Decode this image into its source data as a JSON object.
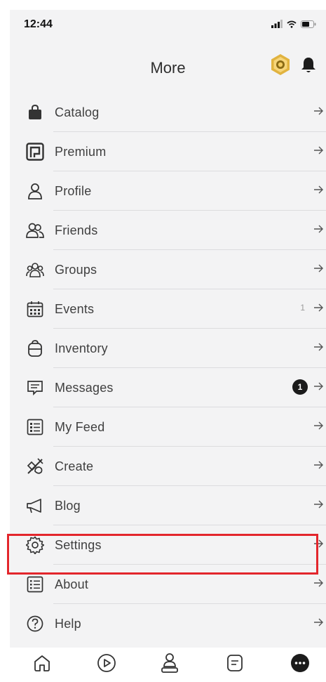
{
  "status_bar": {
    "time": "12:44"
  },
  "header": {
    "title": "More"
  },
  "menu": {
    "items": [
      {
        "label": "Catalog",
        "icon": "shopping-bag-icon"
      },
      {
        "label": "Premium",
        "icon": "premium-icon"
      },
      {
        "label": "Profile",
        "icon": "person-icon"
      },
      {
        "label": "Friends",
        "icon": "friends-icon"
      },
      {
        "label": "Groups",
        "icon": "groups-icon"
      },
      {
        "label": "Events",
        "icon": "calendar-icon",
        "count": "1"
      },
      {
        "label": "Inventory",
        "icon": "backpack-icon"
      },
      {
        "label": "Messages",
        "icon": "message-icon",
        "badge": "1"
      },
      {
        "label": "My Feed",
        "icon": "feed-icon"
      },
      {
        "label": "Create",
        "icon": "create-tools-icon"
      },
      {
        "label": "Blog",
        "icon": "megaphone-icon"
      },
      {
        "label": "Settings",
        "icon": "gear-icon"
      },
      {
        "label": "About",
        "icon": "about-icon"
      },
      {
        "label": "Help",
        "icon": "help-icon"
      }
    ]
  },
  "highlighted_item": "Settings",
  "tab_bar": {
    "tabs": [
      {
        "icon": "home-icon"
      },
      {
        "icon": "play-icon"
      },
      {
        "icon": "avatar-icon"
      },
      {
        "icon": "chat-icon"
      },
      {
        "icon": "more-icon"
      }
    ]
  },
  "colors": {
    "background": "#f3f3f4",
    "highlight": "#e3262c",
    "robux_gold": "#d9a93a",
    "text": "#3f3f3f"
  }
}
